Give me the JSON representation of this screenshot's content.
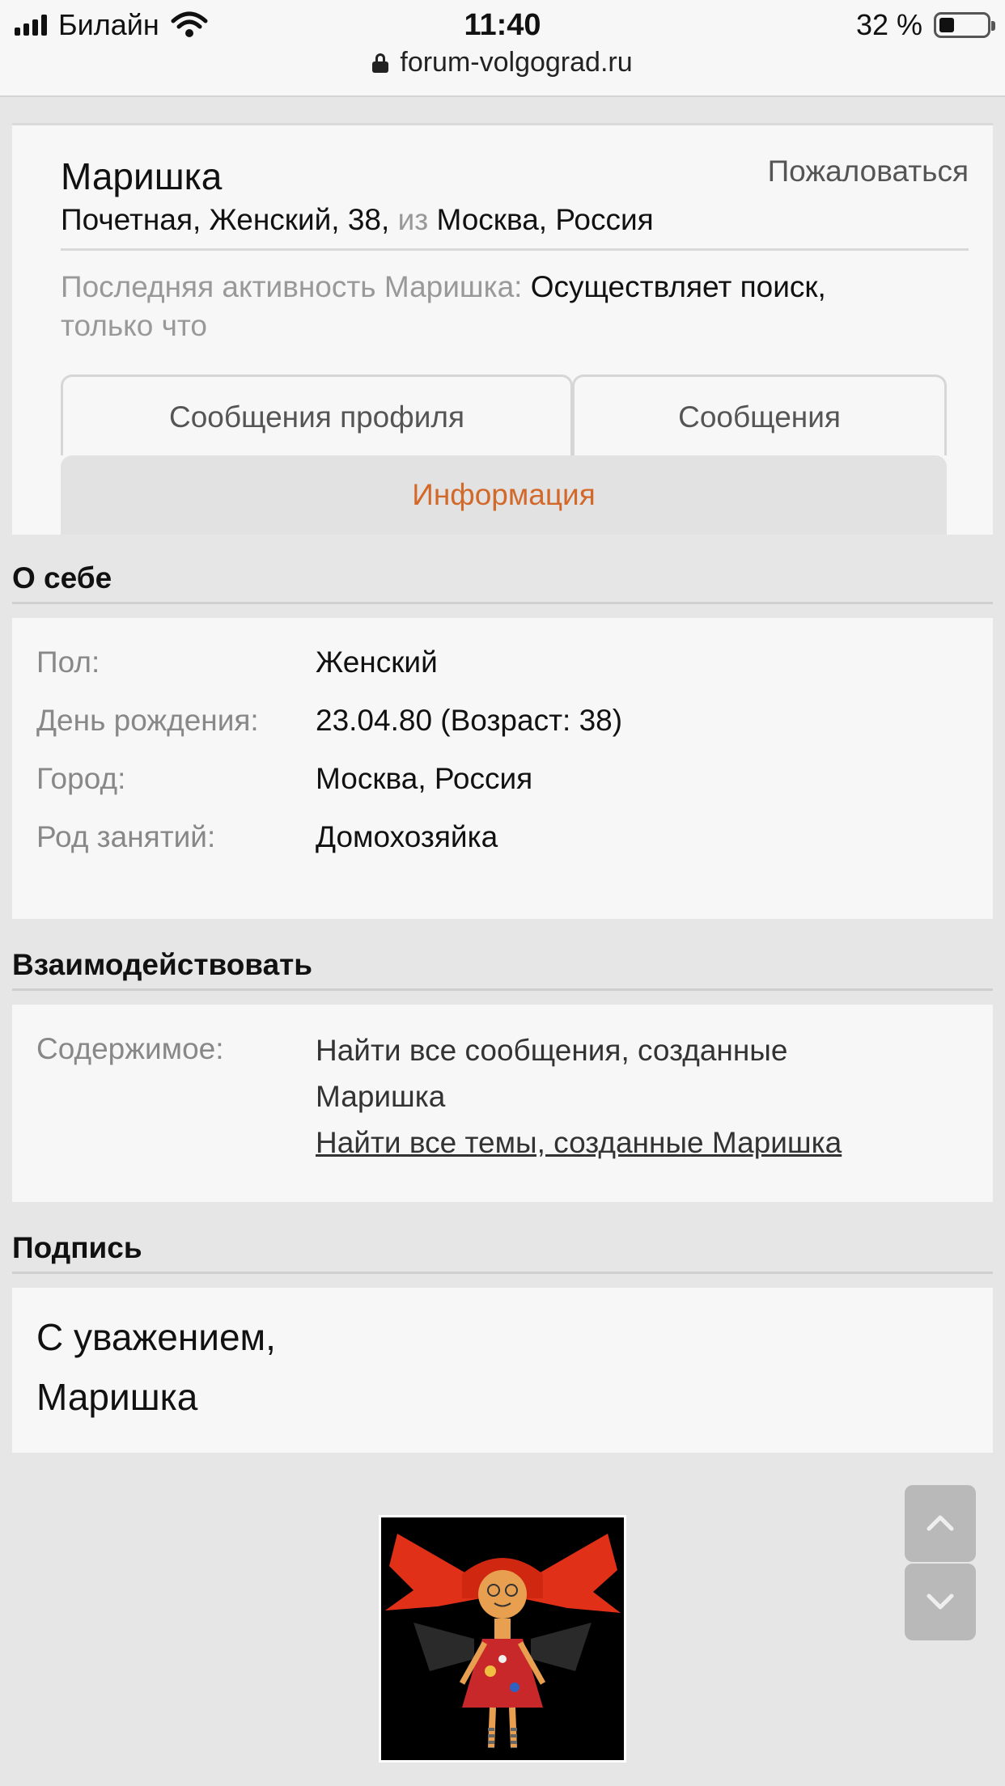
{
  "status_bar": {
    "carrier": "Билайн",
    "time": "11:40",
    "battery_text": "32 %",
    "battery_level": 0.32
  },
  "browser": {
    "url": "forum-volgograd.ru"
  },
  "profile": {
    "name": "Маришка",
    "report_label": "Пожаловаться",
    "info_main": "Почетная, Женский, 38,",
    "info_from": "из",
    "info_location": "Москва, Россия",
    "activity_label": "Последняя активность Маришка:",
    "activity_value": "Осуществляет поиск,",
    "activity_time": "только что"
  },
  "tabs": {
    "profile_posts": "Сообщения профиля",
    "messages": "Сообщения",
    "info": "Информация"
  },
  "about": {
    "title": "О себе",
    "rows": [
      {
        "label": "Пол:",
        "value": "Женский"
      },
      {
        "label": "День рождения:",
        "value": "23.04.80 (Возраст: 38)"
      },
      {
        "label": "Город:",
        "value": "Москва, Россия"
      },
      {
        "label": "Род занятий:",
        "value": "Домохозяйка"
      }
    ]
  },
  "interact": {
    "title": "Взаимодействовать",
    "label": "Содержимое:",
    "find_posts": "Найти все сообщения, созданные Маришка",
    "find_threads": "Найти все темы, созданные Маришка"
  },
  "signature": {
    "title": "Подпись",
    "line1": "С уважением,",
    "line2": "Маришка"
  },
  "colors": {
    "active_tab": "#d2692a",
    "page_bg": "#e6e6e6",
    "card_bg": "#f7f7f7"
  }
}
